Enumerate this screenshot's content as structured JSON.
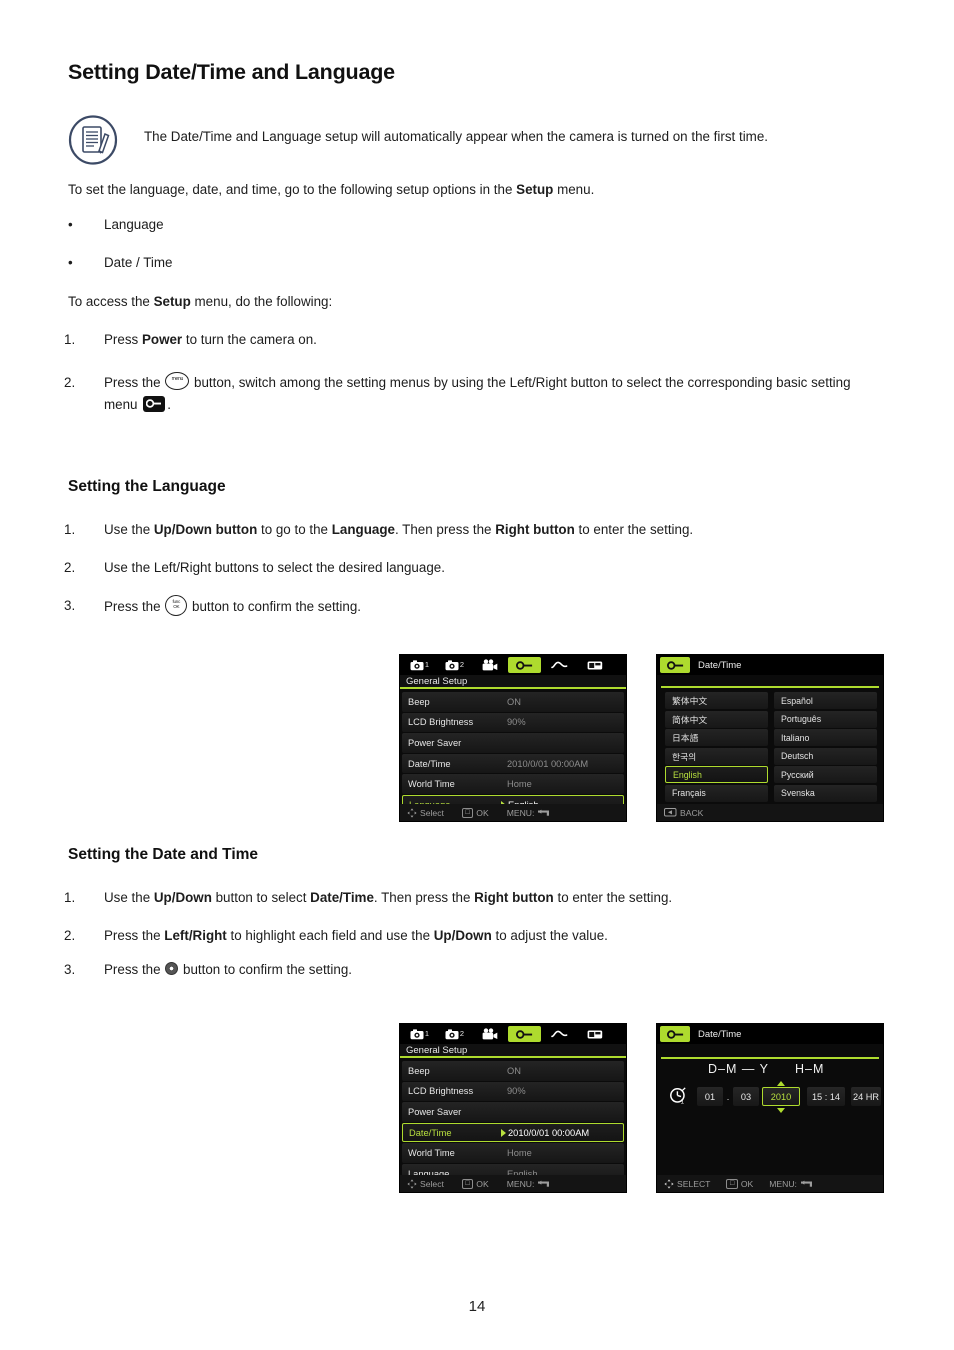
{
  "document": {
    "title": "Setting Date/Time and Language",
    "page_number": "14"
  },
  "note": {
    "icon": "note-document-pencil-icon",
    "text": "The Date/Time and Language setup will automatically appear when the camera is turned on the first time."
  },
  "intro": {
    "lead_before": "To set the language, date, and time, go to the following setup options in the ",
    "lead_bold": "Setup",
    "lead_after": " menu.",
    "bullets": [
      "Language",
      "Date / Time"
    ],
    "access_before": "To access the ",
    "access_bold": "Setup",
    "access_after": " menu, do the following:"
  },
  "setup_steps": [
    {
      "num": "1.",
      "part1": "Press  ",
      "bold1": "Power",
      "part2": "  to turn the camera on."
    },
    {
      "num": "2.",
      "part1": "Press the ",
      "icon1": "menu-button-icon",
      "part2": " button,  switch among the setting menus by using the Left/Right button to select the corresponding basic setting menu ",
      "icon2": "setup-wrench-icon",
      "part3": "."
    }
  ],
  "language_section": {
    "heading": "Setting the Language",
    "steps": [
      {
        "num": "1.",
        "part1": "Use the ",
        "bold1": "Up/Down button",
        "part2": " to go to the ",
        "bold2": "Language",
        "part3": ". Then press the ",
        "bold3": "Right button",
        "part4": " to enter the setting."
      },
      {
        "num": "2.",
        "part1": "Use the Left/Right buttons to select the desired language."
      },
      {
        "num": "3.",
        "part1": "Press the ",
        "icon1": "func-ok-button-icon",
        "part2": " button to confirm the setting."
      }
    ]
  },
  "datetime_section": {
    "heading": "Setting the Date and Time",
    "steps": [
      {
        "num": "1.",
        "part1": "Use the ",
        "bold1": "Up/Down",
        "part2": " button to select ",
        "bold2": "Date/Time",
        "part3": ". Then press the ",
        "bold3": "Right button",
        "part4": " to enter the setting."
      },
      {
        "num": "2.",
        "part1": "Press the ",
        "bold1": "Left/Right",
        "part2": " to highlight each field and use the ",
        "bold2": "Up/Down",
        "part3": " to adjust the value."
      },
      {
        "num": "3.",
        "part1": "Press the ",
        "icon1": "ok-round-button-icon",
        "part2": " button to confirm the setting."
      }
    ]
  },
  "screens": {
    "accent_green": "#aedb2e",
    "label_green": "#b9e13f",
    "background": "#0b0b0b",
    "general_setup_language": {
      "title": "General Setup",
      "tabs": [
        {
          "icon": "camera-icon",
          "index": "1",
          "active": false
        },
        {
          "icon": "camera-icon",
          "index": "2",
          "active": false
        },
        {
          "icon": "movie-camera-icon",
          "index": "",
          "active": false
        },
        {
          "icon": "wrench-setup-icon",
          "index": "",
          "active": true
        },
        {
          "icon": "curve-wave-icon",
          "index": "",
          "active": false
        },
        {
          "icon": "connection-card-icon",
          "index": "",
          "active": false
        }
      ],
      "rows": [
        {
          "label": "Beep",
          "value": "ON",
          "selected": false
        },
        {
          "label": "LCD Brightness",
          "value": "90%",
          "selected": false
        },
        {
          "label": "Power Saver",
          "value": "",
          "selected": false
        },
        {
          "label": "Date/Time",
          "value": "2010/0/01 00:00AM",
          "selected": false
        },
        {
          "label": "World Time",
          "value": "Home",
          "selected": false
        },
        {
          "label": "Language",
          "value": "English",
          "selected": true
        }
      ],
      "footer": [
        {
          "key": "dpad-icon",
          "label": "Select"
        },
        {
          "key": "ok-key-icon",
          "label": "OK"
        },
        {
          "key": "",
          "label": "MENU:"
        }
      ]
    },
    "language_picker": {
      "tab_icon": "wrench-setup-icon",
      "title": "Date/Time",
      "languages": [
        {
          "label": "繁体中文",
          "selected": false
        },
        {
          "label": "Español",
          "selected": false
        },
        {
          "label": "简体中文",
          "selected": false
        },
        {
          "label": "Português",
          "selected": false
        },
        {
          "label": "日本語",
          "selected": false
        },
        {
          "label": "Italiano",
          "selected": false
        },
        {
          "label": "한국의",
          "selected": false
        },
        {
          "label": "Deutsch",
          "selected": false
        },
        {
          "label": "English",
          "selected": true
        },
        {
          "label": "Русский",
          "selected": false
        },
        {
          "label": "Français",
          "selected": false
        },
        {
          "label": "Svenska",
          "selected": false
        }
      ],
      "footer": {
        "key": "left-arrow-key-icon",
        "label": "BACK"
      }
    },
    "general_setup_datetime": {
      "title": "General Setup",
      "tabs": [
        {
          "icon": "camera-icon",
          "index": "1",
          "active": false
        },
        {
          "icon": "camera-icon",
          "index": "2",
          "active": false
        },
        {
          "icon": "movie-camera-icon",
          "index": "",
          "active": false
        },
        {
          "icon": "wrench-setup-icon",
          "index": "",
          "active": true
        },
        {
          "icon": "curve-wave-icon",
          "index": "",
          "active": false
        },
        {
          "icon": "connection-card-icon",
          "index": "",
          "active": false
        }
      ],
      "rows": [
        {
          "label": "Beep",
          "value": "ON",
          "selected": false
        },
        {
          "label": "LCD Brightness",
          "value": "90%",
          "selected": false
        },
        {
          "label": "Power Saver",
          "value": "",
          "selected": false
        },
        {
          "label": "Date/Time",
          "value": "2010/0/01 00:00AM",
          "selected": true
        },
        {
          "label": "World Time",
          "value": "Home",
          "selected": false
        },
        {
          "label": "Language",
          "value": "English",
          "selected": false
        }
      ],
      "footer": [
        {
          "key": "dpad-icon",
          "label": "Select"
        },
        {
          "key": "ok-key-icon",
          "label": "OK"
        },
        {
          "key": "",
          "label": "MENU:"
        }
      ]
    },
    "datetime_editor": {
      "tab_icon": "wrench-setup-icon",
      "title": "Date/Time",
      "format_date": "D–M — Y",
      "format_time": "H–M",
      "clock_icon": "clock-icon",
      "day": "01",
      "day_sep": ".",
      "month": "03",
      "year": "2010",
      "year_selected": true,
      "time": "15 : 14",
      "hour_format": "24 HR",
      "footer": [
        {
          "key": "dpad-icon",
          "label": "SELECT"
        },
        {
          "key": "ok-key-icon",
          "label": "OK"
        },
        {
          "key": "",
          "label": "MENU:"
        }
      ]
    }
  }
}
